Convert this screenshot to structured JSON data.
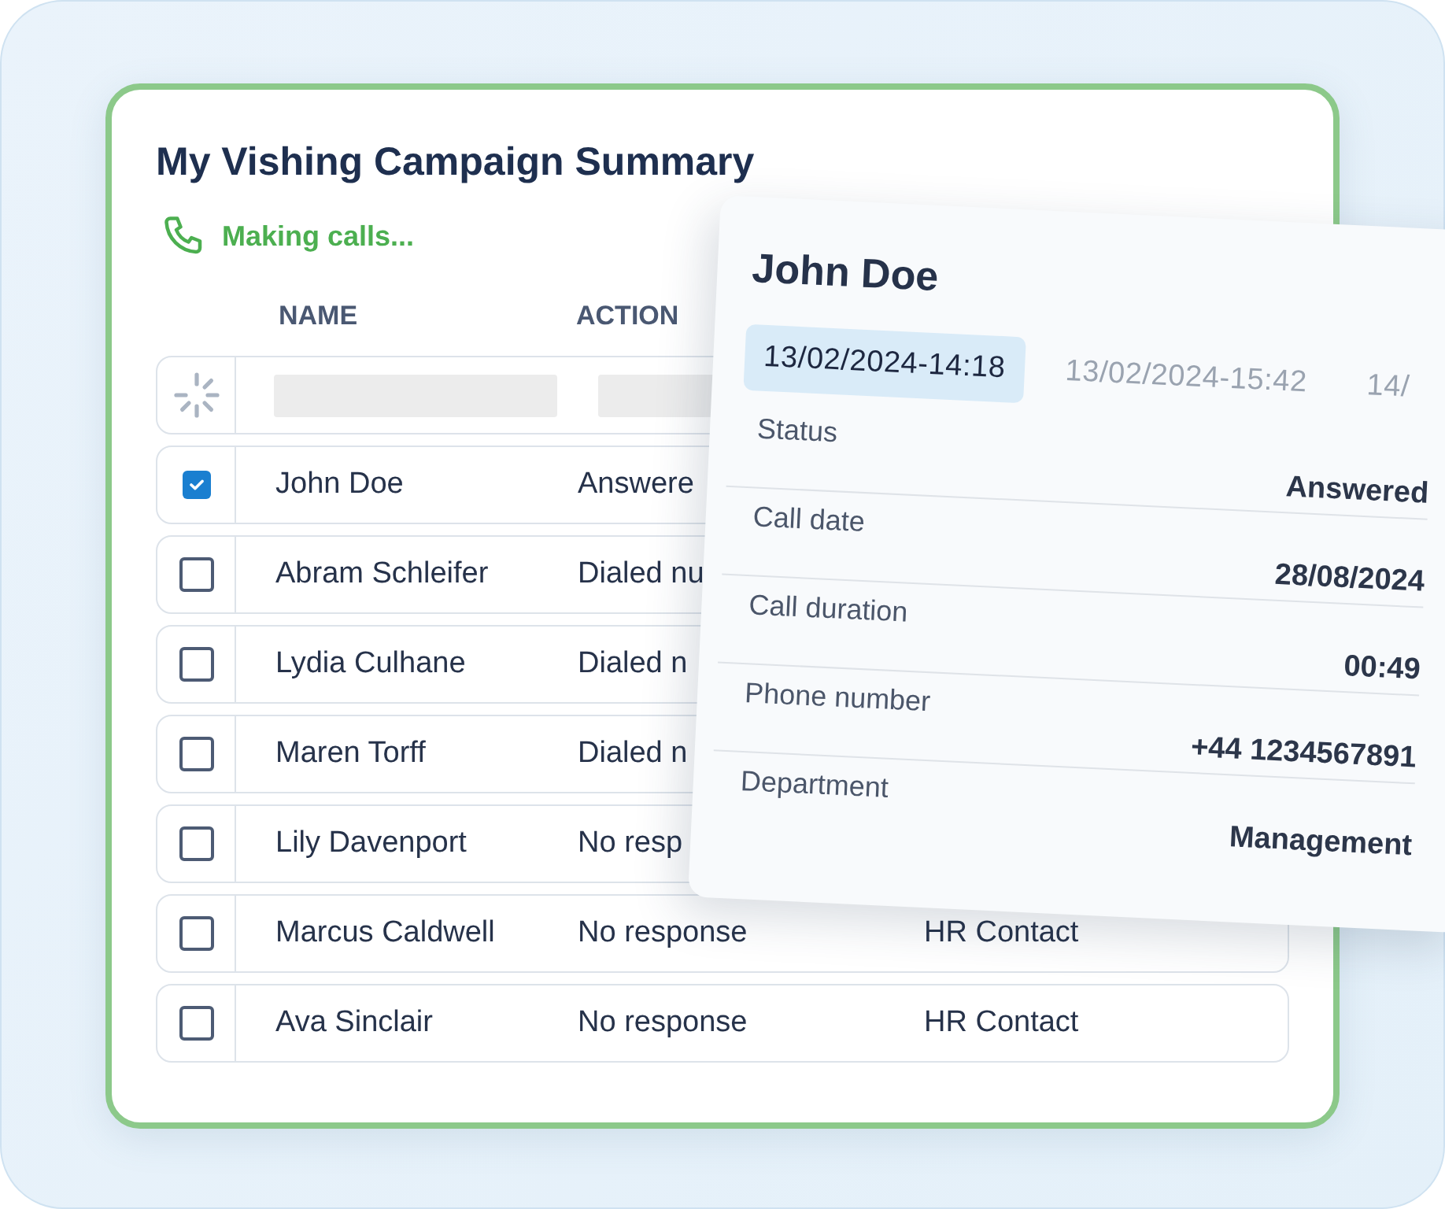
{
  "title": "My Vishing Campaign Summary",
  "status": {
    "text": "Making calls..."
  },
  "table": {
    "columns": [
      "NAME",
      "ACTION"
    ],
    "rows": [
      {
        "kind": "loading"
      },
      {
        "kind": "contact",
        "checked": true,
        "name": "John Doe",
        "action": "Answere"
      },
      {
        "kind": "contact",
        "checked": false,
        "name": "Abram Schleifer",
        "action": "Dialed nu"
      },
      {
        "kind": "contact",
        "checked": false,
        "name": "Lydia Culhane",
        "action": "Dialed n"
      },
      {
        "kind": "contact",
        "checked": false,
        "name": "Maren Torff",
        "action": "Dialed n"
      },
      {
        "kind": "contact",
        "checked": false,
        "name": "Lily Davenport",
        "action": "No resp"
      },
      {
        "kind": "contact",
        "checked": false,
        "name": "Marcus Caldwell",
        "action": "No response",
        "column_3": "HR Contact"
      },
      {
        "kind": "contact",
        "checked": false,
        "name": "Ava Sinclair",
        "action": "No response",
        "column_3": "HR Contact"
      }
    ]
  },
  "detail": {
    "name": "John Doe",
    "tabs": [
      {
        "label": "13/02/2024-14:18",
        "selected": true
      },
      {
        "label": "13/02/2024-15:42",
        "selected": false
      },
      {
        "label": "14/",
        "selected": false
      }
    ],
    "fields": [
      {
        "label": "Status",
        "value": "Answered"
      },
      {
        "label": "Call date",
        "value": "28/08/2024"
      },
      {
        "label": "Call duration",
        "value": "00:49"
      },
      {
        "label": "Phone number",
        "value": "+44 1234567891"
      },
      {
        "label": "Department",
        "value": "Management"
      }
    ]
  }
}
